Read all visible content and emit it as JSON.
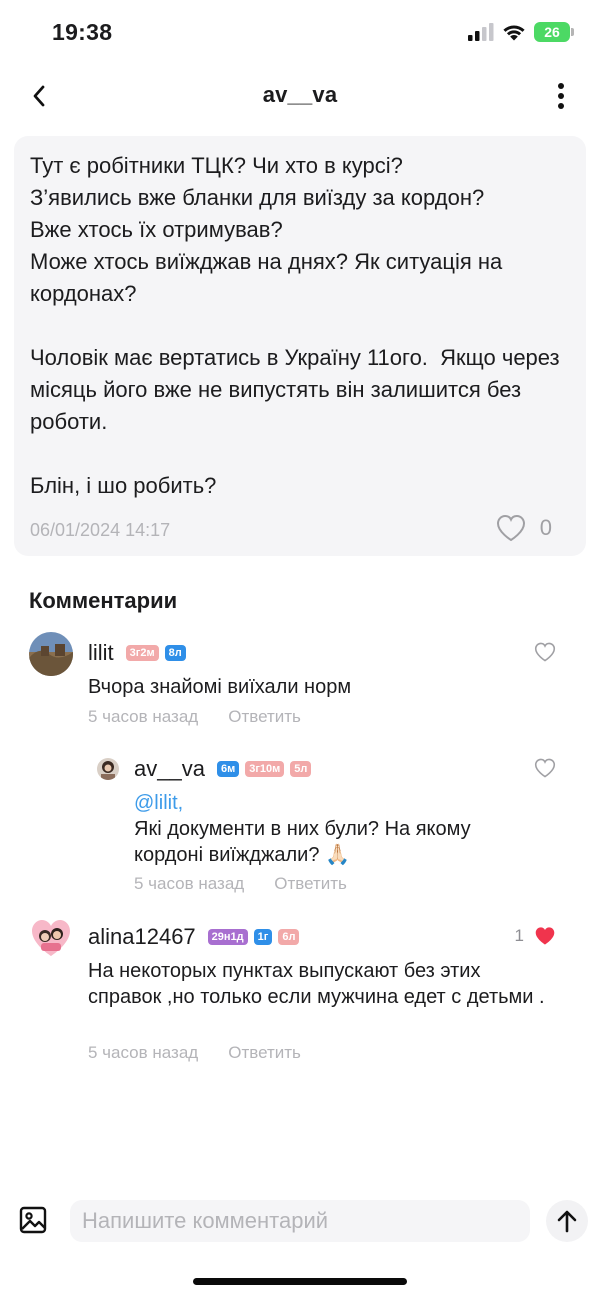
{
  "status_bar": {
    "time": "19:38",
    "battery": "26"
  },
  "header": {
    "title": "av__va",
    "back_icon": "chevron-left-icon",
    "more_icon": "more-vertical-icon"
  },
  "post": {
    "text": "Тут є робітники ТЦК? Чи хто в курсі?\nЗ’явились вже бланки для виїзду за кордон?\nВже хтось їх отримував?\nМоже хтось виїжджав на днях? Як ситуація на кордонах?\n\nЧоловік має вертатись в Україну 11ого.  Якщо через місяць його вже не випустять він залишится без роботи.\n\nБлін, і шо робить?",
    "date": "06/01/2024 14:17",
    "likes": "0"
  },
  "comments_section": {
    "title": "Комментарии"
  },
  "comments": [
    {
      "username": "lilit",
      "badges": [
        {
          "text": "3г2м",
          "color": "#f2a9a9"
        },
        {
          "text": "8л",
          "color": "#2f8fe8"
        }
      ],
      "text": "Вчора знайомі виїхали норм",
      "time": "5 часов назад",
      "reply_label": "Ответить"
    },
    {
      "username": "av__va",
      "badges": [
        {
          "text": "6м",
          "color": "#2f8fe8"
        },
        {
          "text": "3г10м",
          "color": "#f2a9a9"
        },
        {
          "text": "5л",
          "color": "#f2a9a9"
        }
      ],
      "mention": "@lilit,",
      "text": "Які документи в них були? На якому кордоні виїжджали? 🙏🏻",
      "time": "5 часов назад",
      "reply_label": "Ответить"
    },
    {
      "username": "alina12467",
      "badges": [
        {
          "text": "29н1д",
          "color": "#a86fd0"
        },
        {
          "text": "1г",
          "color": "#2f8fe8"
        },
        {
          "text": "6л",
          "color": "#f2a9a9"
        }
      ],
      "likes": "1",
      "text": "На некоторых пунктах выпускают без этих справок ,но только если мужчина едет с детьми .",
      "time": "5 часов назад",
      "reply_label": "Ответить"
    }
  ],
  "composer": {
    "placeholder": "Напишите комментарий",
    "image_icon": "image-icon",
    "send_icon": "arrow-up-icon"
  },
  "colors": {
    "accent": "#3d9be9",
    "like_active": "#f0344d",
    "muted": "#b4b4b8",
    "card_bg": "#f5f5f7"
  }
}
